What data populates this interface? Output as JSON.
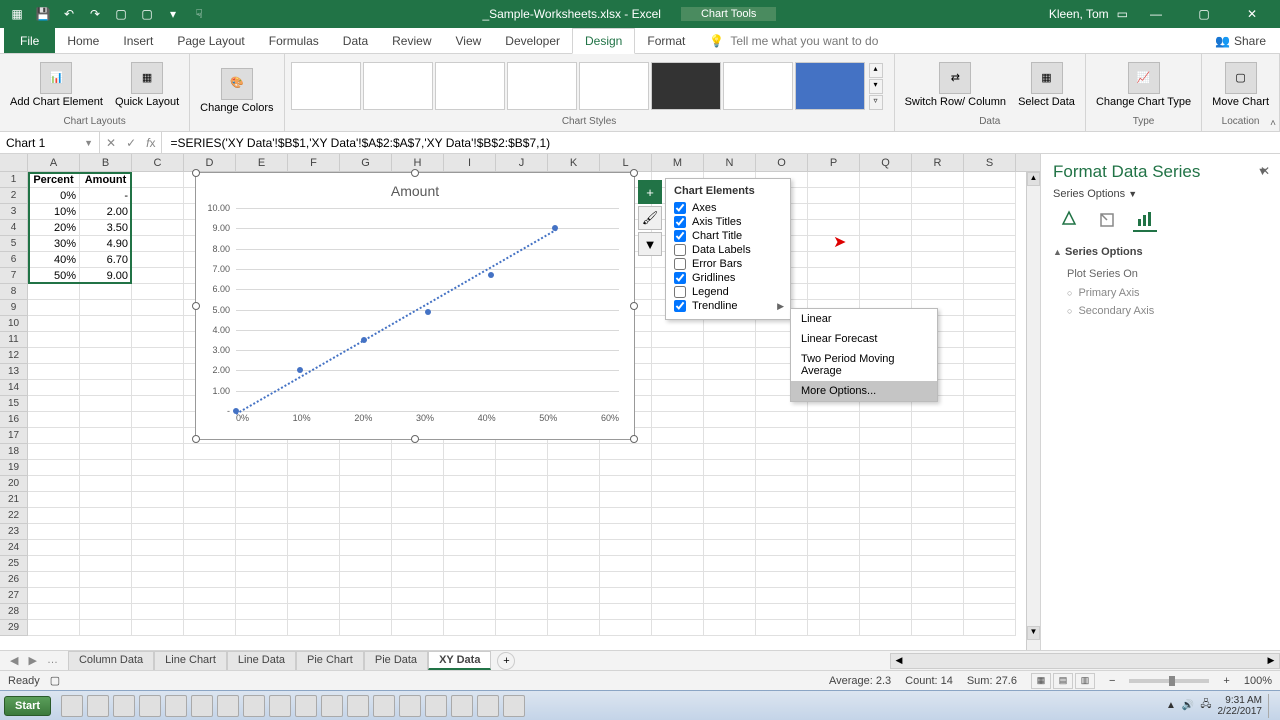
{
  "titlebar": {
    "filename": "_Sample-Worksheets.xlsx - Excel",
    "context_tab": "Chart Tools",
    "user": "Kleen, Tom"
  },
  "ribbon_tabs": {
    "file": "File",
    "home": "Home",
    "insert": "Insert",
    "page_layout": "Page Layout",
    "formulas": "Formulas",
    "data": "Data",
    "review": "Review",
    "view": "View",
    "developer": "Developer",
    "design": "Design",
    "format": "Format",
    "tell_me": "Tell me what you want to do",
    "share": "Share"
  },
  "ribbon": {
    "chart_layouts": {
      "add_element": "Add Chart Element",
      "quick_layout": "Quick Layout",
      "label": "Chart Layouts"
    },
    "change_colors": "Change Colors",
    "chart_styles_label": "Chart Styles",
    "data_group": {
      "switch": "Switch Row/ Column",
      "select": "Select Data",
      "label": "Data"
    },
    "type_group": {
      "change": "Change Chart Type",
      "label": "Type"
    },
    "location_group": {
      "move": "Move Chart",
      "label": "Location"
    }
  },
  "name_box": "Chart 1",
  "formula": "=SERIES('XY Data'!$B$1,'XY Data'!$A$2:$A$7,'XY Data'!$B$2:$B$7,1)",
  "columns": [
    "A",
    "B",
    "C",
    "D",
    "E",
    "F",
    "G",
    "H",
    "I",
    "J",
    "K",
    "L",
    "M",
    "N",
    "O",
    "P",
    "Q",
    "R",
    "S"
  ],
  "rows": [
    "1",
    "2",
    "3",
    "4",
    "5",
    "6",
    "7",
    "8",
    "9",
    "10",
    "11",
    "12",
    "13",
    "14",
    "15",
    "16",
    "17",
    "18",
    "19",
    "20",
    "21",
    "22",
    "23",
    "24",
    "25",
    "26",
    "27",
    "28",
    "29"
  ],
  "cells": {
    "headers": [
      "Percent",
      "Amount"
    ],
    "data": [
      [
        "0%",
        "-"
      ],
      [
        "10%",
        "2.00"
      ],
      [
        "20%",
        "3.50"
      ],
      [
        "30%",
        "4.90"
      ],
      [
        "40%",
        "6.70"
      ],
      [
        "50%",
        "9.00"
      ]
    ]
  },
  "chart_data": {
    "type": "scatter",
    "title": "Amount",
    "xlabel": "",
    "ylabel": "",
    "x_ticks": [
      "0%",
      "10%",
      "20%",
      "30%",
      "40%",
      "50%",
      "60%"
    ],
    "y_ticks": [
      "-",
      "1.00",
      "2.00",
      "3.00",
      "4.00",
      "5.00",
      "6.00",
      "7.00",
      "8.00",
      "9.00",
      "10.00"
    ],
    "xlim": [
      0,
      60
    ],
    "ylim": [
      0,
      10
    ],
    "series": [
      {
        "name": "Amount",
        "x": [
          0,
          10,
          20,
          30,
          40,
          50
        ],
        "y": [
          0,
          2.0,
          3.5,
          4.9,
          6.7,
          9.0
        ]
      }
    ],
    "trendline": "linear"
  },
  "chart_elements": {
    "title": "Chart Elements",
    "items": [
      {
        "label": "Axes",
        "checked": true
      },
      {
        "label": "Axis Titles",
        "checked": true
      },
      {
        "label": "Chart Title",
        "checked": true
      },
      {
        "label": "Data Labels",
        "checked": false
      },
      {
        "label": "Error Bars",
        "checked": false
      },
      {
        "label": "Gridlines",
        "checked": true
      },
      {
        "label": "Legend",
        "checked": false
      },
      {
        "label": "Trendline",
        "checked": true,
        "has_submenu": true
      }
    ]
  },
  "trendline_submenu": {
    "items": [
      "Linear",
      "Linear Forecast",
      "Two Period Moving Average",
      "More Options..."
    ],
    "hover_index": 3
  },
  "format_pane": {
    "title": "Format Data Series",
    "subtitle": "Series Options",
    "section": "Series Options",
    "plot_on": "Plot Series On",
    "opts": [
      "Primary Axis",
      "Secondary Axis"
    ]
  },
  "sheet_tabs": [
    "Column Data",
    "Line Chart",
    "Line Data",
    "Pie Chart",
    "Pie Data",
    "XY Data"
  ],
  "active_sheet": "XY Data",
  "status": {
    "ready": "Ready",
    "average": "Average: 2.3",
    "count": "Count: 14",
    "sum": "Sum: 27.6",
    "zoom": "100%"
  },
  "taskbar": {
    "start": "Start",
    "time": "9:31 AM",
    "date": "2/22/2017"
  }
}
